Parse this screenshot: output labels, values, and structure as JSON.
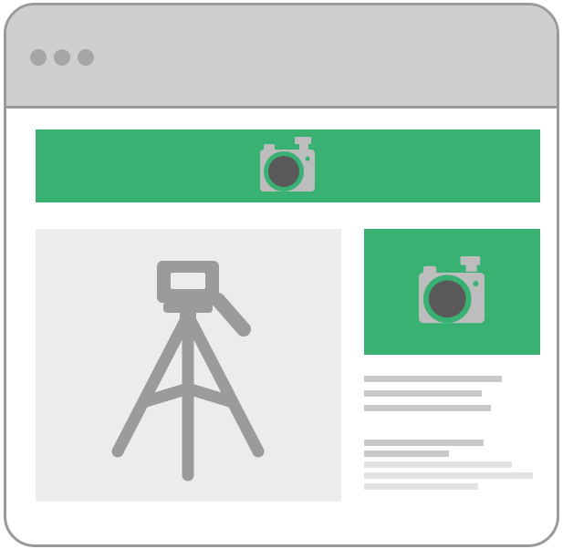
{
  "colors": {
    "frame": "#9a9a9a",
    "titlebar": "#d0cfcf",
    "dot": "#a6a6a6",
    "accent_green": "#38b173",
    "icon_gray": "#bdbdbd",
    "lens_dark": "#595959",
    "panel_gray": "#ececec",
    "tripod_gray": "#9b9b9b",
    "line_dark": "#c9c9c9",
    "line_light": "#e2e2e2"
  },
  "titlebar": {
    "dots": [
      "window-dot",
      "window-dot",
      "window-dot"
    ]
  },
  "hero_banner": {
    "icon": "camera-icon"
  },
  "media_panel": {
    "icon": "tripod-icon"
  },
  "side_card": {
    "icon": "camera-icon",
    "text_block_1": [
      {
        "level": 0.78,
        "shade": "dark"
      },
      {
        "level": 0.67,
        "shade": "dark"
      },
      {
        "level": 0.72,
        "shade": "dark"
      }
    ],
    "text_block_2": [
      {
        "level": 0.68,
        "shade": "dark"
      },
      {
        "level": 0.48,
        "shade": "dark"
      },
      {
        "level": 0.84,
        "shade": "light"
      },
      {
        "level": 0.96,
        "shade": "light"
      },
      {
        "level": 0.65,
        "shade": "light"
      }
    ]
  }
}
